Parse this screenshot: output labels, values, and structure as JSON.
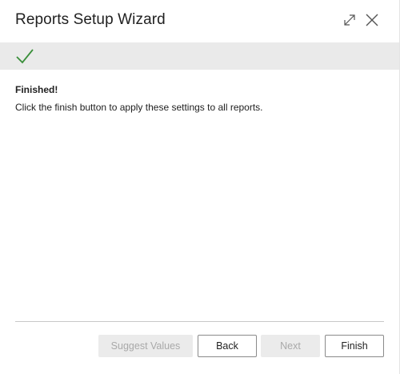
{
  "dialog": {
    "title": "Reports Setup Wizard",
    "icons": {
      "expand": "expand-icon",
      "close": "close-icon",
      "status": "checkmark-icon"
    },
    "status_color": "#3a8f3a"
  },
  "content": {
    "heading": "Finished!",
    "body": "Click the finish button to apply these settings to all reports."
  },
  "buttons": {
    "suggest": {
      "label": "Suggest Values",
      "enabled": false
    },
    "back": {
      "label": "Back",
      "enabled": true
    },
    "next": {
      "label": "Next",
      "enabled": false
    },
    "finish": {
      "label": "Finish",
      "enabled": true
    }
  }
}
